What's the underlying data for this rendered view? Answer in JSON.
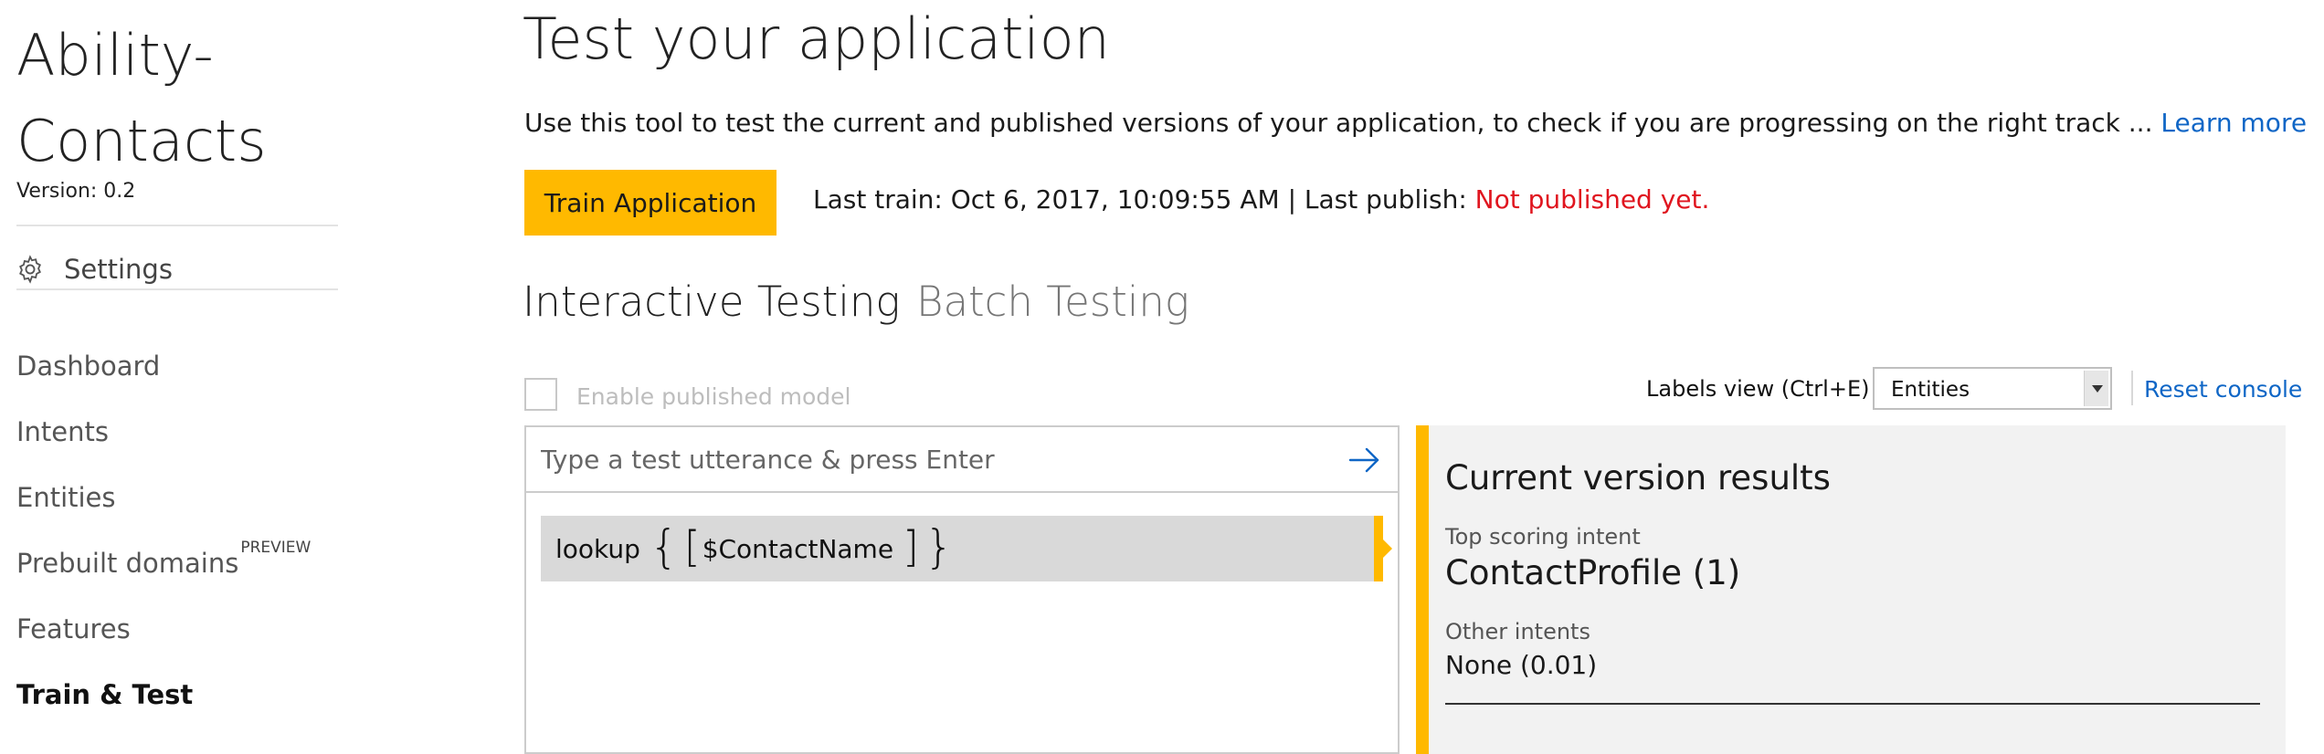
{
  "app": {
    "title": "Ability-Contacts",
    "version_label": "Version:  0.2"
  },
  "sidebar": {
    "settings_label": "Settings",
    "settings_icon": "gear-icon",
    "items": [
      {
        "label": "Dashboard"
      },
      {
        "label": "Intents"
      },
      {
        "label": "Entities"
      },
      {
        "label": "Prebuilt domains",
        "badge": "PREVIEW"
      },
      {
        "label": "Features"
      },
      {
        "label": "Train & Test",
        "active": true
      }
    ]
  },
  "main": {
    "title": "Test your application",
    "description": "Use this tool to test the current and published versions of your application, to check if you are progressing on the right track ... ",
    "learn_more": "Learn more",
    "train_button": "Train Application",
    "last_train": "Last train: Oct 6, 2017, 10:09:55 AM  |  Last publish: ",
    "publish_status": "Not published yet.",
    "tabs": [
      {
        "label": "Interactive Testing",
        "active": true
      },
      {
        "label": "Batch Testing",
        "active": false
      }
    ]
  },
  "controls": {
    "enable_published_label": "Enable published model",
    "enable_published_checked": false,
    "labels_view_label": "Labels view (Ctrl+E)",
    "labels_view_value": "Entities",
    "reset_console": "Reset console"
  },
  "test_panel": {
    "input_placeholder": "Type a test utterance & press Enter",
    "input_value": "",
    "submit_icon": "arrow-right-icon",
    "utterance": {
      "prefix": "lookup",
      "open_brace": "{",
      "open_bracket": "[",
      "entity": "$ContactName",
      "close_bracket": "]",
      "close_brace": "}"
    }
  },
  "results": {
    "title": "Current version results",
    "top_intent_label": "Top scoring intent",
    "top_intent_value": "ContactProfile (1)",
    "other_intents_label": "Other intents",
    "other_intents_value": "None (0.01)"
  },
  "colors": {
    "accent": "#ffb900",
    "link": "#0f66c6",
    "error": "#e0151f",
    "results_bg": "#f2f2f2"
  }
}
